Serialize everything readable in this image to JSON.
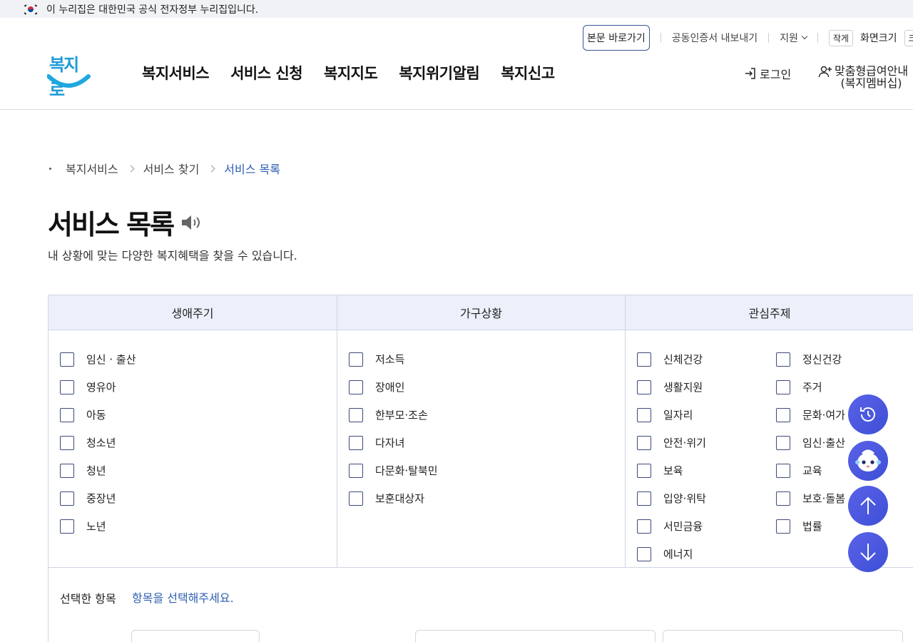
{
  "gov_banner": {
    "text": "이 누리집은 대한민국 공식 전자정부 누리집입니다."
  },
  "utility": {
    "skip": "본문 바로가기",
    "cert": "공동인증서 내보내기",
    "support": "지원",
    "small": "작게",
    "screen_size": "화면크기",
    "large": "크게"
  },
  "logo": {
    "text": "복지로"
  },
  "gnb": [
    "복지서비스",
    "서비스 신청",
    "복지지도",
    "복지위기알림",
    "복지신고"
  ],
  "account": {
    "login": "로그인",
    "member_line1": "맞춤형급여안내",
    "member_line2": "(복지멤버십)"
  },
  "breadcrumb": [
    "복지서비스",
    "서비스 찾기",
    "서비스 목록"
  ],
  "page": {
    "title": "서비스 목록",
    "subtitle": "내 상황에 맞는 다양한 복지혜택을 찾을 수 있습니다."
  },
  "filters": {
    "life_cycle": {
      "header": "생애주기",
      "items": [
        "임신 · 출산",
        "영유아",
        "아동",
        "청소년",
        "청년",
        "중장년",
        "노년"
      ]
    },
    "household": {
      "header": "가구상황",
      "items": [
        "저소득",
        "장애인",
        "한부모·조손",
        "다자녀",
        "다문화·탈북민",
        "보훈대상자"
      ]
    },
    "interest": {
      "header": "관심주제",
      "left": [
        "신체건강",
        "생활지원",
        "일자리",
        "안전·위기",
        "보육",
        "입양·위탁",
        "서민금융",
        "에너지"
      ],
      "right": [
        "정신건강",
        "주거",
        "문화·여가",
        "임신·출산",
        "교육",
        "보호·돌봄",
        "법률"
      ]
    }
  },
  "selected": {
    "label": "선택한 항목",
    "hint": "항목을 선택해주세요."
  },
  "fabs": [
    "history-icon",
    "chatbot-icon",
    "arrow-up-icon",
    "arrow-down-icon"
  ]
}
